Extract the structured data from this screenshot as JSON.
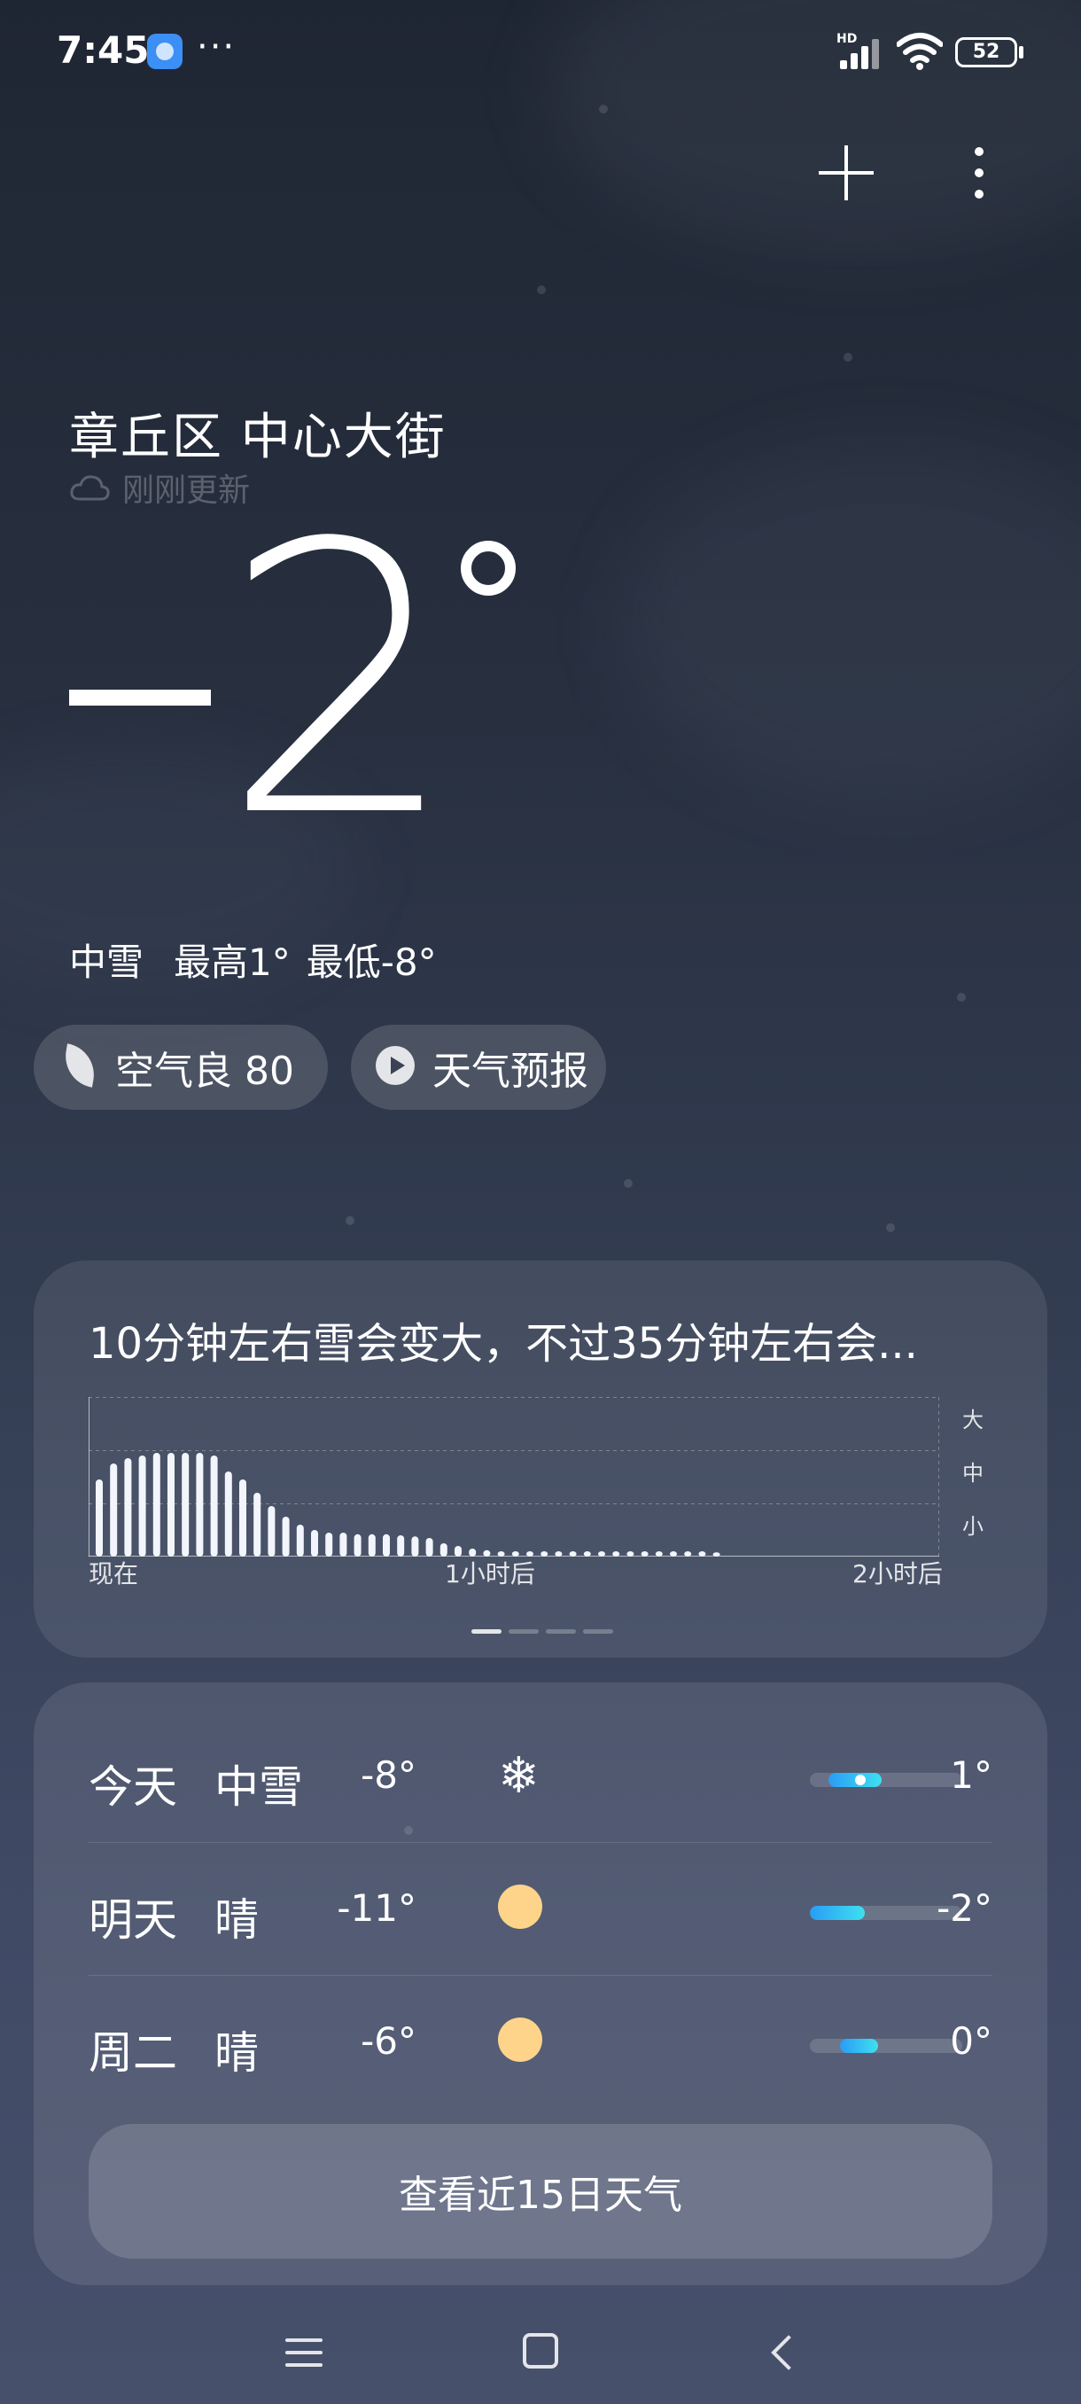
{
  "status_bar": {
    "time": "7:45",
    "more": "···",
    "network_tag": "HD",
    "battery": "52",
    "app_icon": "browser-icon"
  },
  "header": {
    "add_icon": "plus-icon",
    "menu_icon": "more-vertical-icon"
  },
  "location": {
    "name": "章丘区 中心大街",
    "update_status": "刚刚更新",
    "update_icon": "cloud-icon"
  },
  "current": {
    "temperature": "2",
    "condition": "中雪",
    "high": "最高1°",
    "low": "最低-8°"
  },
  "pills": {
    "air_quality": "空气良 80",
    "air_icon": "leaf-icon",
    "forecast_video": "天气预报",
    "forecast_icon": "play-icon"
  },
  "precip": {
    "summary": "10分钟左右雪会变大，不过35分钟左右会...",
    "legend": [
      "大",
      "中",
      "小"
    ],
    "x_labels": [
      "现在",
      "1小时后",
      "2小时后"
    ],
    "page_indicator": {
      "count": 4,
      "active": 0
    }
  },
  "chart_data": {
    "type": "bar",
    "x_range_minutes": [
      0,
      120
    ],
    "levels": [
      "小",
      "中",
      "大"
    ],
    "ylim": [
      0,
      3
    ],
    "values": [
      1.45,
      1.75,
      1.85,
      1.9,
      1.95,
      1.95,
      1.95,
      1.95,
      1.9,
      1.6,
      1.45,
      1.2,
      0.95,
      0.75,
      0.6,
      0.5,
      0.45,
      0.45,
      0.42,
      0.42,
      0.42,
      0.4,
      0.38,
      0.35,
      0.25,
      0.2,
      0.15,
      0.12,
      0.1,
      0.1,
      0.1,
      0.1,
      0.1,
      0.1,
      0.1,
      0.1,
      0.1,
      0.1,
      0.1,
      0.1,
      0.1,
      0.1,
      0.1,
      0.08
    ]
  },
  "forecast": {
    "rows": [
      {
        "day": "今天",
        "condition": "中雪",
        "icon": "snow-icon",
        "low": "-8°",
        "high": "1°",
        "range_start": 0.12,
        "range_end": 0.47,
        "current": 0.33
      },
      {
        "day": "明天",
        "condition": "晴",
        "icon": "sun-icon",
        "low": "-11°",
        "high": "-2°",
        "range_start": 0.0,
        "range_end": 0.36
      },
      {
        "day": "周二",
        "condition": "晴",
        "icon": "sun-icon",
        "low": "-6°",
        "high": "0°",
        "range_start": 0.2,
        "range_end": 0.45
      }
    ],
    "view_more": "查看近15日天气"
  },
  "nav": {
    "menu_icon": "menu-icon",
    "home_icon": "home-icon",
    "back_icon": "back-icon"
  }
}
